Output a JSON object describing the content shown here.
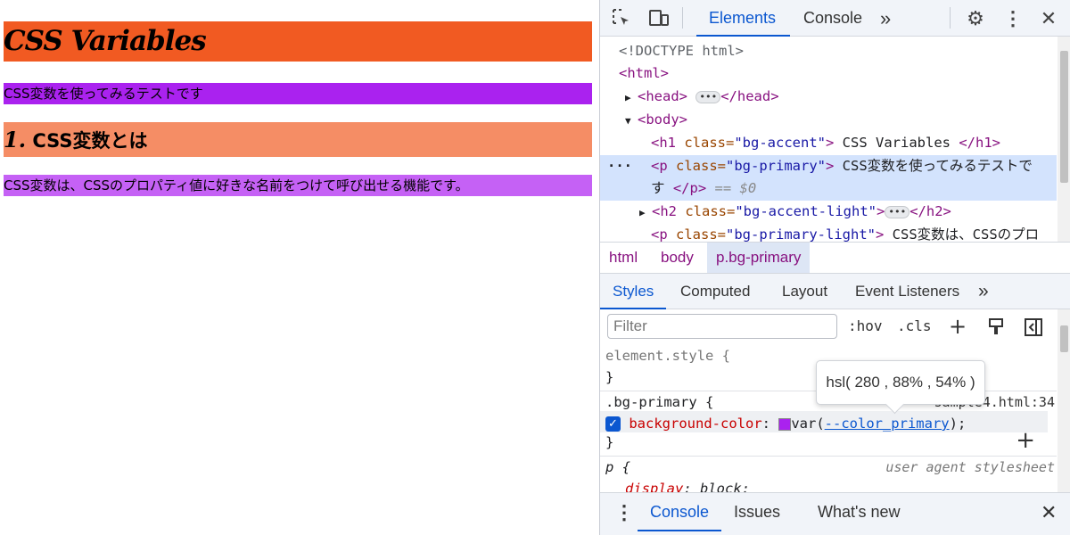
{
  "page": {
    "h1": "CSS Variables",
    "p_primary": "CSS変数を使ってみるテストです",
    "h2_num": "1.",
    "h2_text": " CSS変数とは",
    "p_primary_light": "CSS変数は、CSSのプロパティ値に好きな名前をつけて呼び出せる機能です。",
    "colors": {
      "accent": "#f15a22",
      "primary": "#aa22ef",
      "accent_light": "#f58d65",
      "primary_light": "#c561f5"
    }
  },
  "devtools": {
    "tabs": [
      "Elements",
      "Console"
    ],
    "more_tabs": "»",
    "dom": {
      "doctype": "<!DOCTYPE html>",
      "html_open": "<html>",
      "head_open": "<head>",
      "head_close": "</head>",
      "body_open": "<body>",
      "h1_tag_open": "<h1",
      "h1_attr": "class=",
      "h1_val": "\"bg-accent\"",
      "h1_close_bracket": ">",
      "h1_text": " CSS Variables ",
      "h1_tag_close": "</h1>",
      "p_tag_open": "<p",
      "p_attr": "class=",
      "p_val": "\"bg-primary\"",
      "p_close_bracket": ">",
      "p_text_1": " CSS変数を使ってみるテストで",
      "p_text_2": "す ",
      "p_tag_close": "</p>",
      "eq0": " == $0",
      "h2_tag_open": "<h2",
      "h2_attr": "class=",
      "h2_val": "\"bg-accent-light\"",
      "h2_close_bracket": ">",
      "h2_tag_close": "</h2>",
      "p2_tag_open": "<p",
      "p2_attr": "class=",
      "p2_val": "\"bg-primary-light\"",
      "p2_close_bracket": ">",
      "p2_text": " CSS変数は、CSSのプロ"
    },
    "breadcrumb": [
      "html",
      "body",
      "p.bg-primary"
    ],
    "subtabs": [
      "Styles",
      "Computed",
      "Layout",
      "Event Listeners"
    ],
    "filter_placeholder": "Filter",
    "hov": ":hov",
    "cls": ".cls",
    "styles": {
      "element_style": "element.style {",
      "close_brace": "}",
      "rule_selector": ".bg-primary {",
      "source": "sample4.html:34",
      "prop_name": "background-color",
      "colon": ": ",
      "var_open": "var(",
      "var_name": "--color_primary",
      "var_close": ");",
      "ua_selector": "p {",
      "ua_label": "user agent stylesheet",
      "ua_prop": "display",
      "ua_val": "block;"
    },
    "tooltip": "hsl( 280 , 88% , 54% )",
    "drawer_tabs": [
      "Console",
      "Issues",
      "What's new"
    ]
  }
}
